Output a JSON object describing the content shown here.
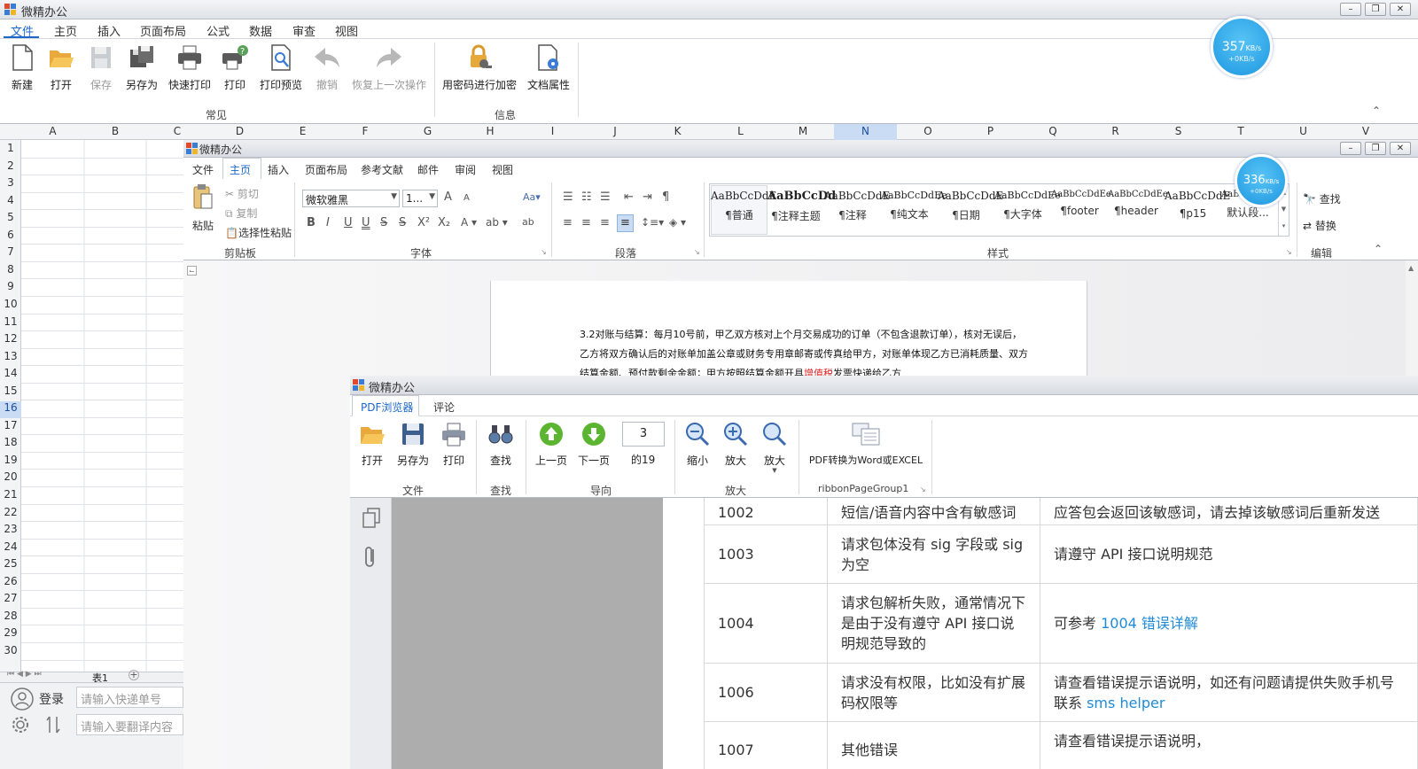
{
  "app": {
    "title": "微精办公",
    "menu": [
      "文件",
      "主页",
      "插入",
      "页面布局",
      "公式",
      "数据",
      "审查",
      "视图"
    ],
    "ribbon_buttons": [
      "新建",
      "打开",
      "保存",
      "另存为",
      "快速打印",
      "打印",
      "打印预览",
      "撤销",
      "恢复上一次操作",
      "用密码进行加密",
      "文档属性"
    ],
    "groups": [
      "常见",
      "信息"
    ],
    "window_buttons": [
      "–",
      "❐",
      "✕"
    ]
  },
  "speed1": {
    "value": "357",
    "unit": "KB/s",
    "sub": "+0KB/s"
  },
  "speed2": {
    "value": "336",
    "unit": "KB/s",
    "sub": "+0KB/s"
  },
  "sheet": {
    "columns": [
      "A",
      "B",
      "C",
      "D",
      "E",
      "F",
      "G",
      "H",
      "I",
      "J",
      "K",
      "L",
      "M",
      "N",
      "O",
      "P",
      "Q",
      "R",
      "S",
      "T",
      "U",
      "V"
    ],
    "rows": [
      "1",
      "2",
      "3",
      "4",
      "5",
      "6",
      "7",
      "8",
      "9",
      "10",
      "11",
      "12",
      "13",
      "14",
      "15",
      "16",
      "17",
      "18",
      "19",
      "20",
      "21",
      "22",
      "23",
      "24",
      "25",
      "26",
      "27",
      "28",
      "29",
      "30"
    ],
    "active_column": "N",
    "active_row": "16",
    "tab": "表1",
    "add_tab": "+"
  },
  "bottom": {
    "login": "登录",
    "express_placeholder": "请输入快递单号",
    "translate_placeholder": "请输入要翻译内容"
  },
  "word": {
    "title": "微精办公",
    "menu": [
      "文件",
      "主页",
      "插入",
      "页面布局",
      "参考文献",
      "邮件",
      "审阅",
      "视图"
    ],
    "clipboard": {
      "paste": "粘贴",
      "cut": "剪切",
      "copy": "复制",
      "paste_special": "选择性粘贴",
      "group": "剪贴板"
    },
    "font": {
      "name": "微软雅黑",
      "size": "1...",
      "group": "字体"
    },
    "paragraph_group": "段落",
    "styles": {
      "preview": [
        "AaBbCcDdE",
        "AaBbCcDd",
        "AaBbCcDdE",
        "AaBbCcDdEe",
        "AaBbCcDdE",
        "AaBbCcDdEe",
        "AaBbCcDdEe",
        "AaBbCcDdEe",
        "AaBbCcDdE",
        "AaBb"
      ],
      "names": [
        "¶普通",
        "¶注释主题",
        "¶注释",
        "¶纯文本",
        "¶日期",
        "¶大字体",
        "¶footer",
        "¶header",
        "¶p15",
        "默认段..."
      ],
      "group": "样式"
    },
    "edit": {
      "find": "查找",
      "replace": "替换",
      "group": "编辑"
    },
    "doc_lines": [
      "3.2对账与结算：每月10号前，甲乙双方核对上个月交易成功的订单（不包含退款订单），核对无误后，",
      "乙方将双方确认后的对账单加盖公章或财务专用章邮寄或传真给甲方，对账单体现乙方已消耗质量、双方",
      "结算金额、预付款剩余金额；甲方按照结算金额开具"
    ],
    "doc_red": "增值税",
    "doc_tail": "发票快递给乙方"
  },
  "pdf": {
    "title": "微精办公",
    "tabs": [
      "PDF浏览器",
      "评论"
    ],
    "buttons": {
      "open": "打开",
      "saveas": "另存为",
      "print": "打印",
      "find": "查找",
      "prev": "上一页",
      "next": "下一页",
      "page": "3",
      "of": "的19",
      "zoomout": "缩小",
      "zoomin": "放大",
      "zoom": "放大",
      "convert": "PDF转换为Word或EXCEL"
    },
    "groups": {
      "file": "文件",
      "find": "查找",
      "nav": "导向",
      "zoom": "放大",
      "custom": "ribbonPageGroup1"
    },
    "table": [
      {
        "code": "1002",
        "desc": "短信/语音内容中含有敏感词",
        "fix": "应答包会返回该敏感词，请去掉该敏感词后重新发送",
        "link": ""
      },
      {
        "code": "1003",
        "desc": "请求包体没有 sig 字段或 sig 为空",
        "fix": "请遵守 API 接口说明规范",
        "link": ""
      },
      {
        "code": "1004",
        "desc": "请求包解析失败，通常情况下是由于没有遵守 API 接口说明规范导致的",
        "fix": "可参考 ",
        "link": "1004 错误详解"
      },
      {
        "code": "1006",
        "desc": "请求没有权限，比如没有扩展码权限等",
        "fix": "请查看错误提示语说明，如还有问题请提供失败手机号联系 ",
        "link": "sms helper"
      },
      {
        "code": "1007",
        "desc": "其他错误",
        "fix": "请查看错误提示语说明，",
        "link": ""
      }
    ]
  }
}
